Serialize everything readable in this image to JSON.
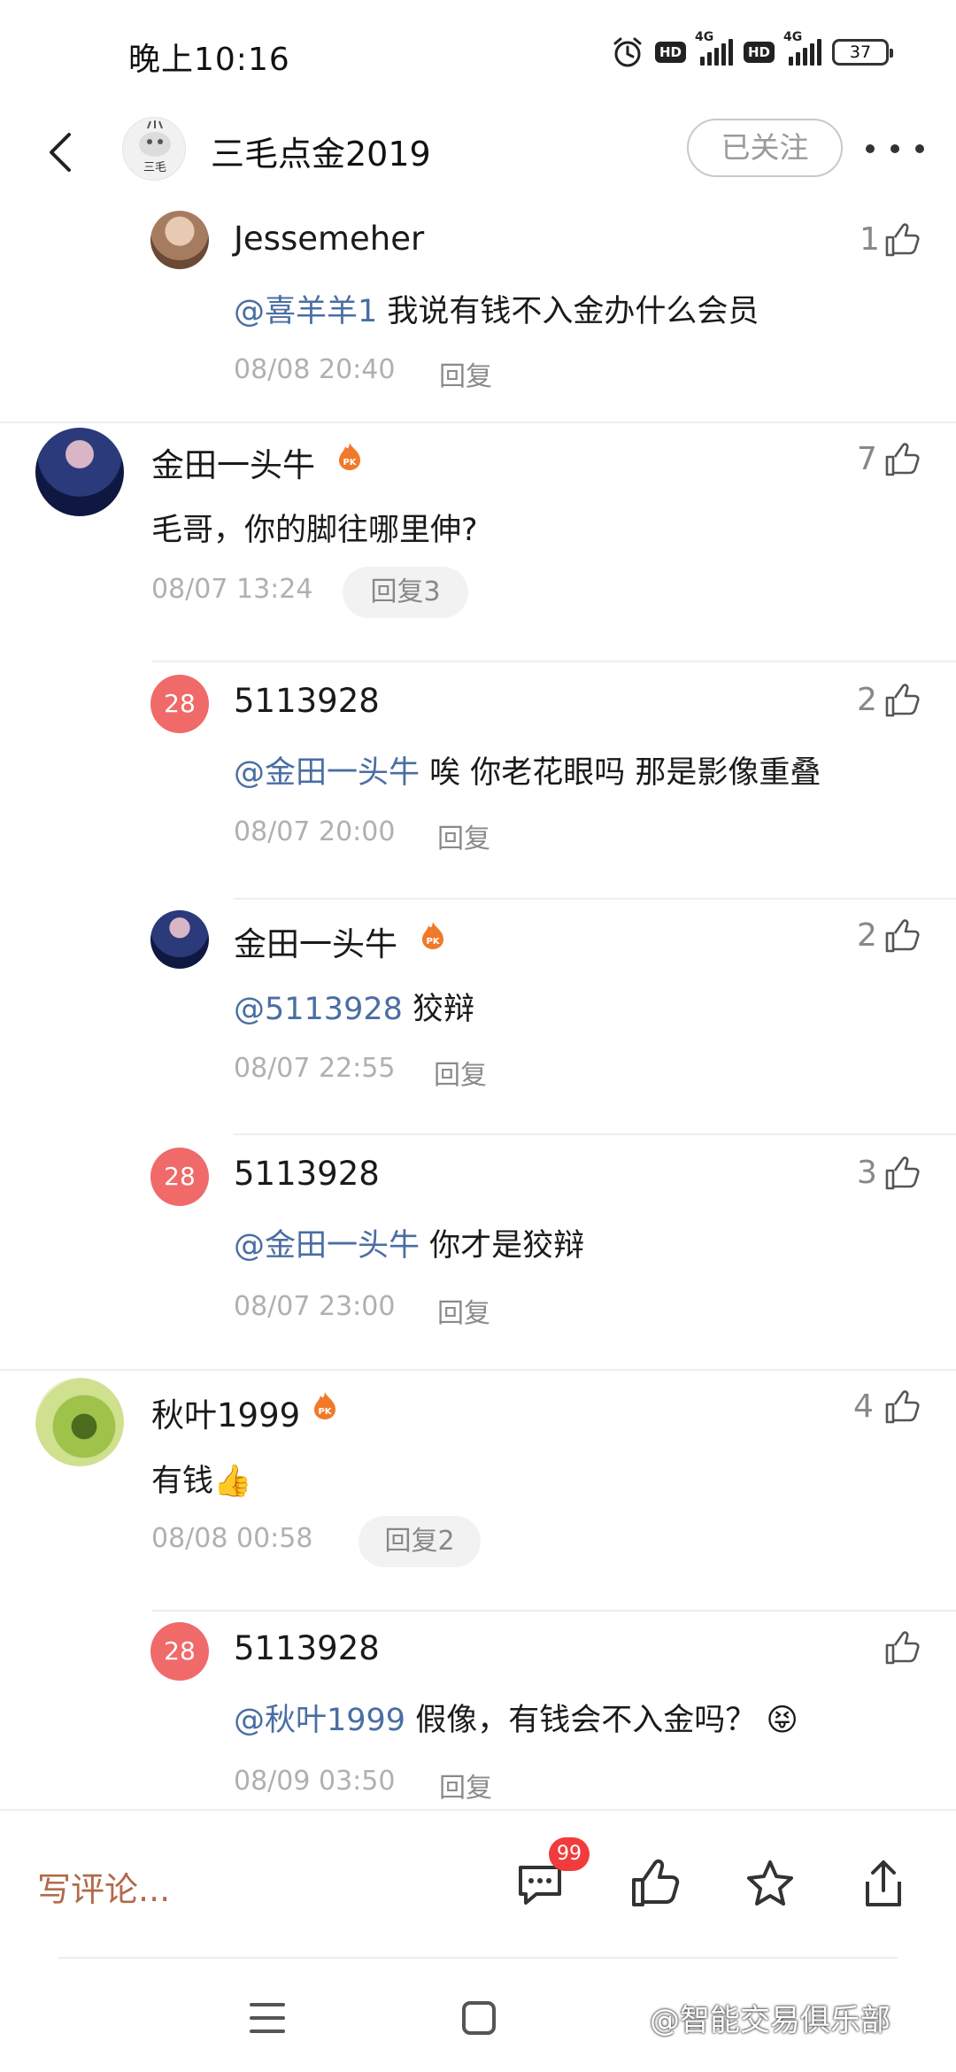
{
  "status_bar": {
    "time": "晚上10:16",
    "hd1": "HD",
    "net1": "4G",
    "hd2": "HD",
    "net2": "4G",
    "battery": "37"
  },
  "header": {
    "author_name": "三毛点金2019",
    "avatar_text": "三毛",
    "follow_label": "已关注"
  },
  "comments": [
    {
      "id": "reply-a",
      "user": "Jessemeher",
      "likes": "1",
      "mention": "@喜羊羊1",
      "text": " 我说有钱不入金办什么会员",
      "time": "08/08 20:40",
      "reply_label": "回复"
    },
    {
      "id": "top-1",
      "user": "金田一头牛",
      "likes": "7",
      "text": "毛哥，你的脚往哪里伸?",
      "time": "08/07 13:24",
      "reply_label": "回复3"
    },
    {
      "id": "reply-b",
      "badge": "28",
      "user": "5113928",
      "likes": "2",
      "mention": "@金田一头牛",
      "text": " 唉 你老花眼吗 那是影像重叠",
      "time": "08/07 20:00",
      "reply_label": "回复"
    },
    {
      "id": "reply-c",
      "user": "金田一头牛",
      "likes": "2",
      "mention": "@5113928",
      "text": " 狡辩",
      "time": "08/07 22:55",
      "reply_label": "回复"
    },
    {
      "id": "reply-d",
      "badge": "28",
      "user": "5113928",
      "likes": "3",
      "mention": "@金田一头牛",
      "text": " 你才是狡辩",
      "time": "08/07 23:00",
      "reply_label": "回复"
    },
    {
      "id": "top-2",
      "user": "秋叶1999",
      "likes": "4",
      "text": "有钱👍",
      "time": "08/08 00:58",
      "reply_label": "回复2"
    },
    {
      "id": "reply-e",
      "badge": "28",
      "user": "5113928",
      "likes": "",
      "mention": "@秋叶1999",
      "text": " 假像，有钱会不入金吗？ 😝",
      "time": "08/09 03:50",
      "reply_label": "回复"
    }
  ],
  "bottom_bar": {
    "write_placeholder": "写评论...",
    "comment_count_badge": "99",
    "icons": [
      "comment-icon",
      "like-icon",
      "star-icon",
      "share-icon"
    ]
  },
  "nav": {
    "watermark": "@智能交易俱乐部"
  },
  "colors": {
    "mention": "#4a6ea2",
    "badge_red": "#f06a6a",
    "write_text": "#b26a4a",
    "notification_badge": "#f03c3c"
  }
}
